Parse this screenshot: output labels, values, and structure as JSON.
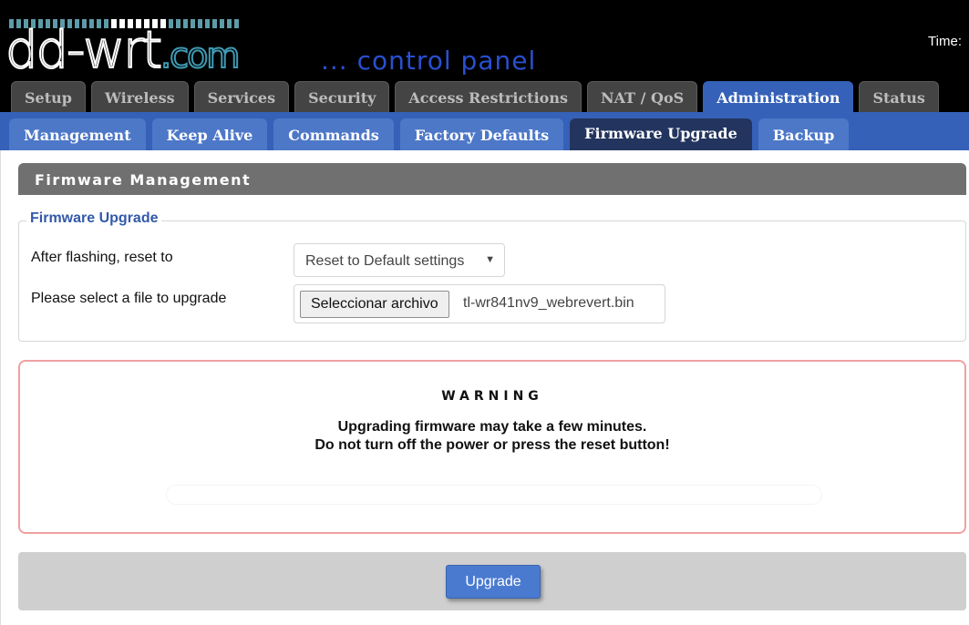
{
  "header": {
    "logo_main": "dd-wrt",
    "logo_suffix": ".com",
    "tagline": "... control panel",
    "time_label": "Time:"
  },
  "main_tabs": [
    {
      "label": "Setup",
      "active": false
    },
    {
      "label": "Wireless",
      "active": false
    },
    {
      "label": "Services",
      "active": false
    },
    {
      "label": "Security",
      "active": false
    },
    {
      "label": "Access Restrictions",
      "active": false
    },
    {
      "label": "NAT / QoS",
      "active": false
    },
    {
      "label": "Administration",
      "active": true
    },
    {
      "label": "Status",
      "active": false
    }
  ],
  "sub_tabs": [
    {
      "label": "Management",
      "active": false
    },
    {
      "label": "Keep Alive",
      "active": false
    },
    {
      "label": "Commands",
      "active": false
    },
    {
      "label": "Factory Defaults",
      "active": false
    },
    {
      "label": "Firmware Upgrade",
      "active": true
    },
    {
      "label": "Backup",
      "active": false
    }
  ],
  "section": {
    "title": "Firmware Management"
  },
  "firmware_upgrade": {
    "legend": "Firmware Upgrade",
    "reset_label": "After flashing, reset to",
    "reset_value": "Reset to Default settings",
    "file_label": "Please select a file to upgrade",
    "file_button": "Seleccionar archivo",
    "file_name": "tl-wr841nv9_webrevert.bin"
  },
  "warning": {
    "title": "WARNING",
    "line1": "Upgrading firmware may take a few minutes.",
    "line2": "Do not turn off the power or press the reset button!"
  },
  "actions": {
    "upgrade_label": "Upgrade"
  },
  "colors": {
    "accent": "#3561b8",
    "active_subtab": "#23355e",
    "warning_border": "#f0a0a0"
  }
}
